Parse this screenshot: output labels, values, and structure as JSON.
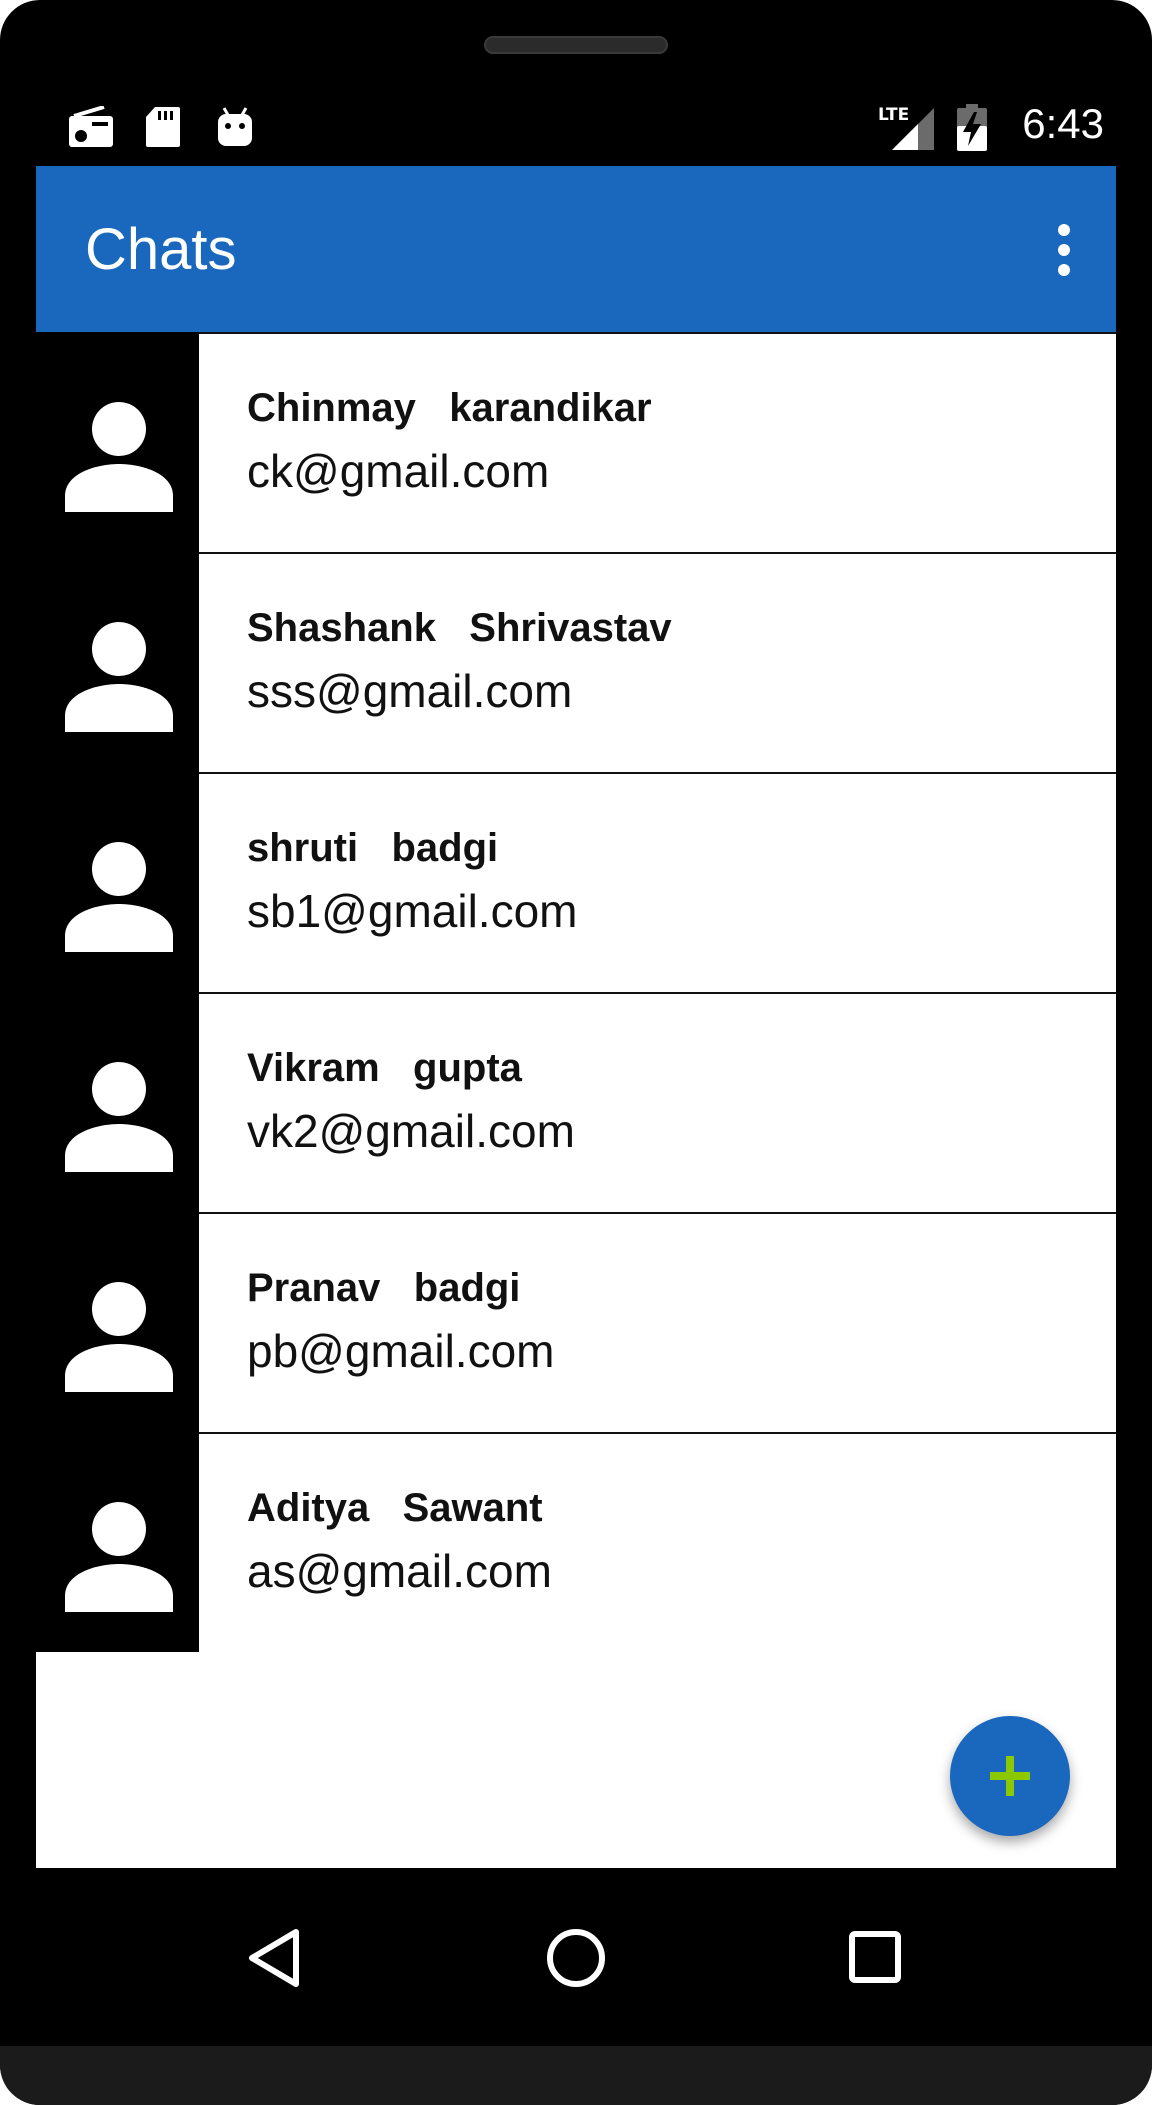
{
  "status_bar": {
    "time": "6:43",
    "network_label": "LTE",
    "left_icons": [
      "radio-icon",
      "sd-card-icon",
      "android-icon"
    ],
    "right_icons": [
      "lte-signal-icon",
      "battery-charging-icon"
    ]
  },
  "app_bar": {
    "title": "Chats",
    "menu_icon": "overflow-menu-icon",
    "color": "#1a67be"
  },
  "contacts": [
    {
      "name": "Chinmay   karandikar",
      "email": "ck@gmail.com"
    },
    {
      "name": "Shashank   Shrivastav",
      "email": "sss@gmail.com"
    },
    {
      "name": "shruti   badgi",
      "email": "sb1@gmail.com"
    },
    {
      "name": "Vikram   gupta",
      "email": "vk2@gmail.com"
    },
    {
      "name": "Pranav   badgi",
      "email": "pb@gmail.com"
    },
    {
      "name": "Aditya   Sawant",
      "email": "as@gmail.com"
    }
  ],
  "fab": {
    "icon": "plus-icon",
    "color": "#1a67be",
    "icon_color": "#8bc800"
  },
  "nav_bar": {
    "buttons": [
      "back-icon",
      "home-icon",
      "recents-icon"
    ]
  }
}
